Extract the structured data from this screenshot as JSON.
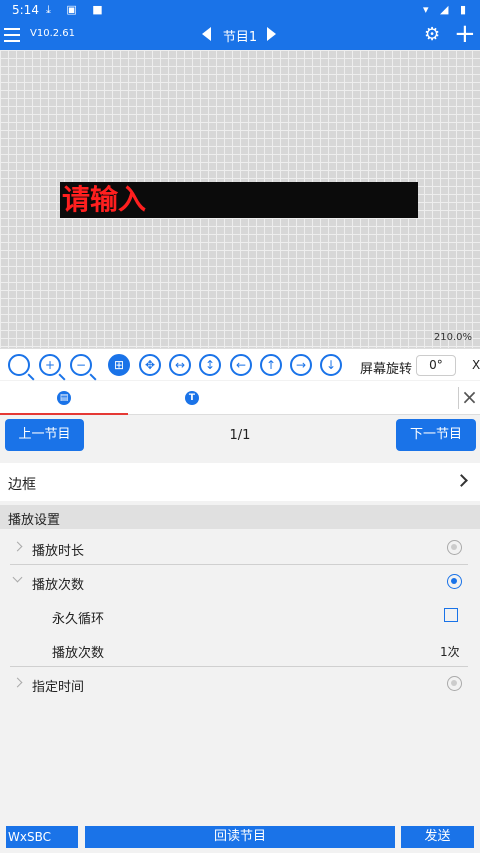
{
  "status_bar": {
    "time": "5:14"
  },
  "app_bar": {
    "version": "V10.2.61",
    "title": "节目1"
  },
  "canvas": {
    "led_text": "请输入",
    "zoom": "210.0%"
  },
  "toolbar": {
    "rotate_label": "屏幕旋转",
    "rotate_value": "0°",
    "close_label": "X"
  },
  "pager": {
    "prev_label": "上一节目",
    "page": "1/1",
    "next_label": "下一节目"
  },
  "border_row": {
    "label": "边框"
  },
  "play_settings": {
    "header": "播放设置",
    "duration_label": "播放时长",
    "count_mode_label": "播放次数",
    "loop_label": "永久循环",
    "count_label": "播放次数",
    "count_value": "1次",
    "time_label": "指定时间"
  },
  "bottom": {
    "device": "WxSBC",
    "readback_label": "回读节目",
    "send_label": "发送"
  },
  "colors": {
    "accent": "#1a73e8",
    "led_text": "#ff1f1f",
    "led_bg": "#0b0b0b"
  }
}
